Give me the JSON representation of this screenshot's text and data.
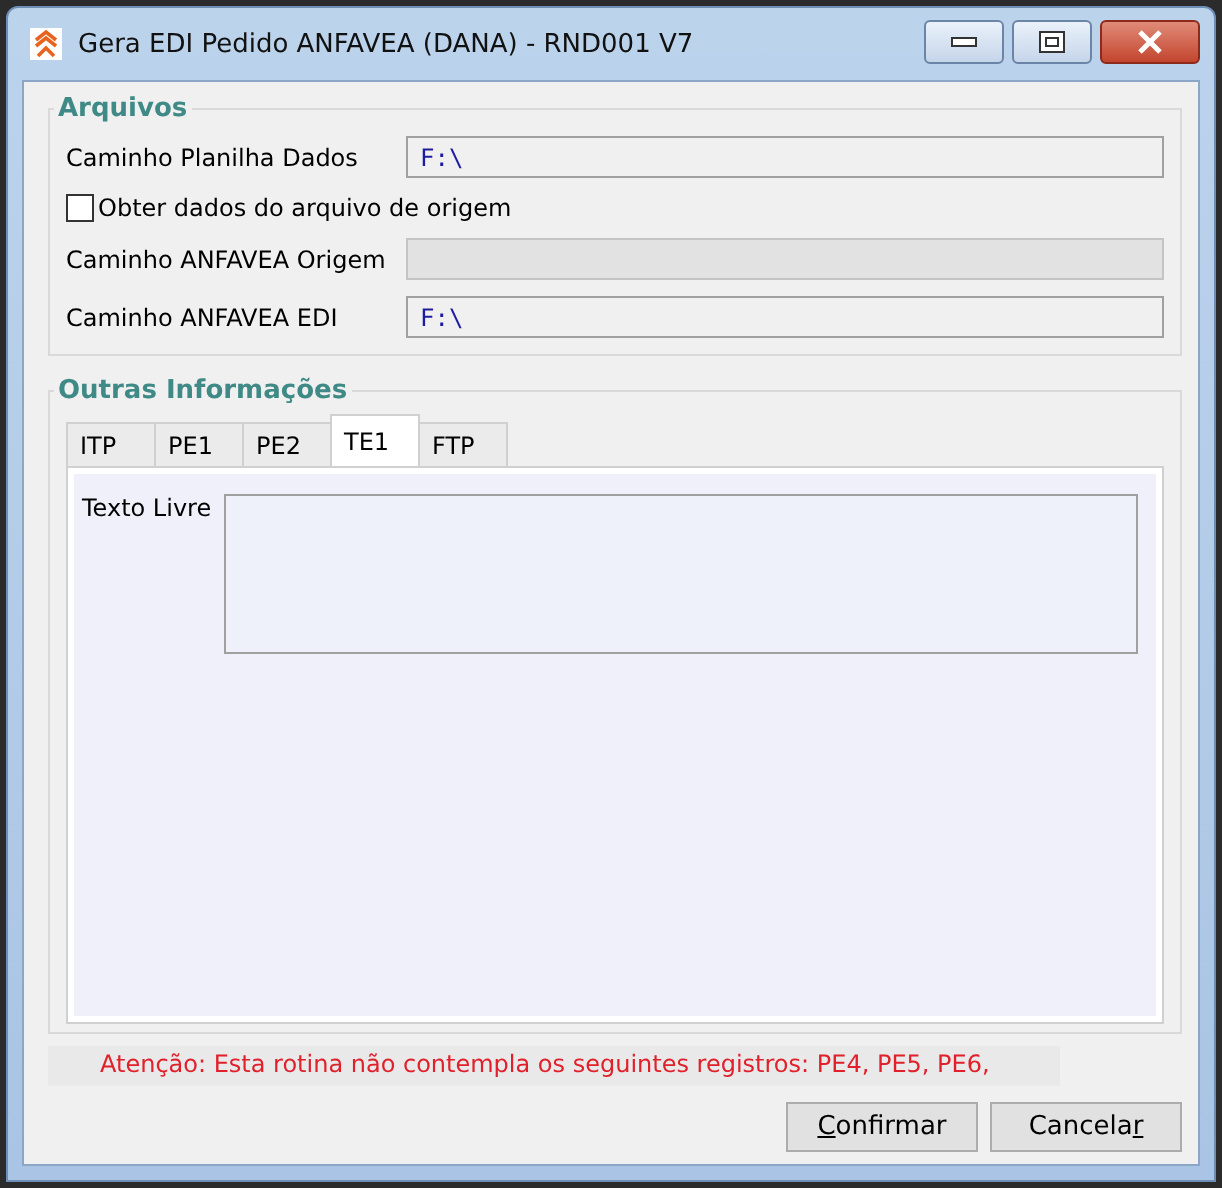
{
  "window": {
    "title": "Gera EDI Pedido ANFAVEA (DANA) - RND001 V7"
  },
  "arquivos": {
    "title": "Arquivos",
    "rows": [
      {
        "kind": "field",
        "label": "Caminho Planilha Dados",
        "value": "F:\\",
        "disabled": false
      },
      {
        "kind": "checkbox",
        "label": "Obter dados do arquivo de origem",
        "checked": false
      },
      {
        "kind": "field",
        "label": "Caminho ANFAVEA Origem",
        "disabled": true
      },
      {
        "kind": "field",
        "label": "Caminho ANFAVEA EDI",
        "value": "F:\\",
        "disabled": false
      }
    ]
  },
  "outras": {
    "title": "Outras Informações",
    "tabs": [
      {
        "label": "ITP",
        "selected": false
      },
      {
        "label": "PE1",
        "selected": false
      },
      {
        "label": "PE2",
        "selected": false
      },
      {
        "label": "TE1",
        "selected": true
      },
      {
        "label": "FTP",
        "selected": false
      }
    ],
    "panel": {
      "label": "Texto Livre"
    }
  },
  "warning": "Atenção: Esta rotina não contempla os seguintes registros: PE4, PE5, PE6,",
  "buttons": [
    {
      "label_parts": [
        {
          "text": "C",
          "underlined": true
        },
        {
          "text": "onfirmar",
          "underlined": false
        }
      ]
    },
    {
      "label_parts": [
        {
          "text": "Cancela",
          "underlined": false
        },
        {
          "text": "r",
          "underlined": true
        }
      ]
    }
  ]
}
